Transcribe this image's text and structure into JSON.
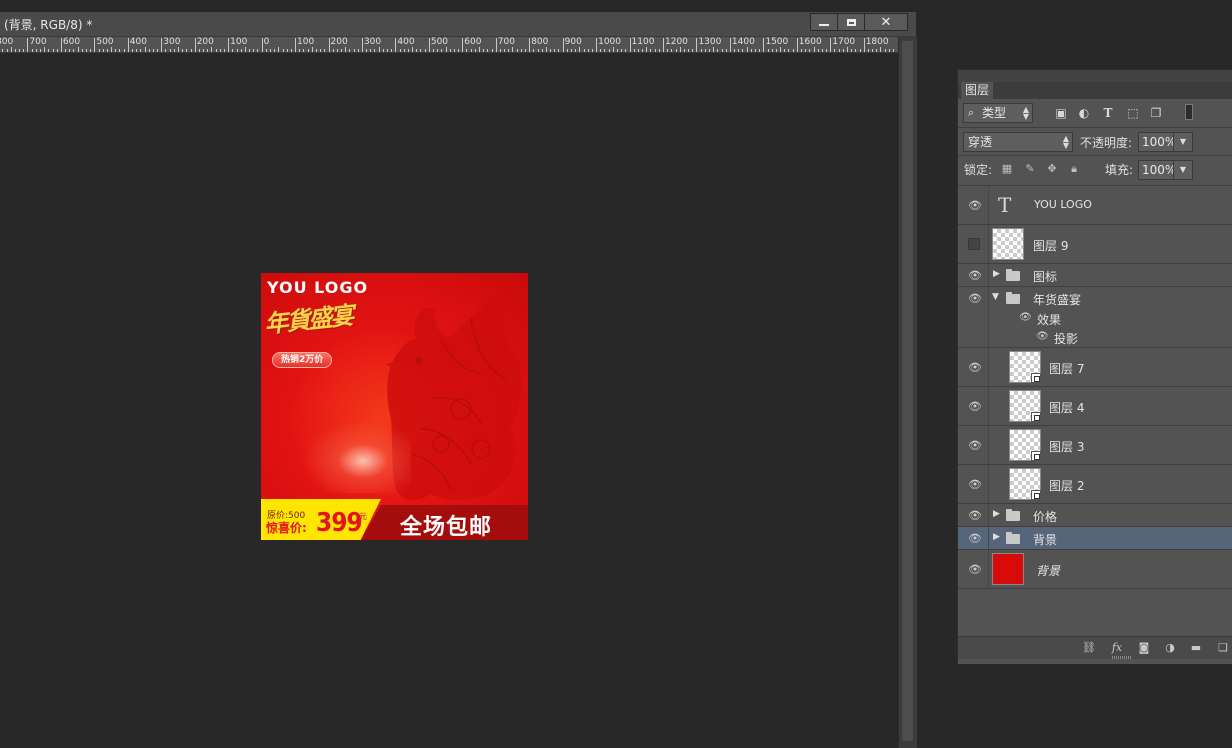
{
  "document": {
    "title": "(背景, RGB/8) *",
    "ruler_labels": [
      "800",
      "700",
      "600",
      "500",
      "400",
      "300",
      "200",
      "100",
      "0",
      "100",
      "200",
      "300",
      "400",
      "500",
      "600",
      "700",
      "800",
      "900",
      "1000",
      "1100",
      "1200",
      "1300",
      "1400",
      "1500",
      "1600",
      "1700",
      "1800"
    ]
  },
  "artwork": {
    "logo": "YOU LOGO",
    "calligraphy": "年貨盛宴",
    "hot_badge": "热销2万价",
    "original_price": "原价:500",
    "surprise_label": "惊喜价:",
    "price": "399",
    "yuan": "元",
    "free_shipping": "全场包邮"
  },
  "layers_panel": {
    "tab": "图层",
    "filter_kind": "类型",
    "blend_mode": "穿透",
    "opacity_label": "不透明度:",
    "opacity_value": "100%",
    "lock_label": "锁定:",
    "fill_label": "填充:",
    "fill_value": "100%",
    "layers": [
      {
        "name": "YOU LOGO",
        "kind": "text",
        "visible": true
      },
      {
        "name": "图层 9",
        "kind": "pixel",
        "visible": false
      },
      {
        "name": "图标",
        "kind": "group-collapsed",
        "visible": true
      },
      {
        "name": "年货盛宴",
        "kind": "group-expanded",
        "visible": true
      },
      {
        "name": "效果",
        "kind": "effects",
        "visible": true
      },
      {
        "name": "投影",
        "kind": "effect",
        "visible": true
      },
      {
        "name": "图层 7",
        "kind": "smart",
        "visible": true
      },
      {
        "name": "图层 4",
        "kind": "smart",
        "visible": true
      },
      {
        "name": "图层 3",
        "kind": "smart",
        "visible": true
      },
      {
        "name": "图层 2",
        "kind": "smart",
        "visible": true
      },
      {
        "name": "价格",
        "kind": "group-collapsed",
        "visible": true
      },
      {
        "name": "背景",
        "kind": "group-collapsed",
        "visible": true,
        "selected": true
      },
      {
        "name": "背景",
        "kind": "background",
        "visible": true
      }
    ]
  },
  "colors": {
    "workspace": "#282828",
    "panel": "#535353",
    "selection": "#56657a",
    "art_red": "#e21313",
    "art_yellow": "#ffe500"
  }
}
